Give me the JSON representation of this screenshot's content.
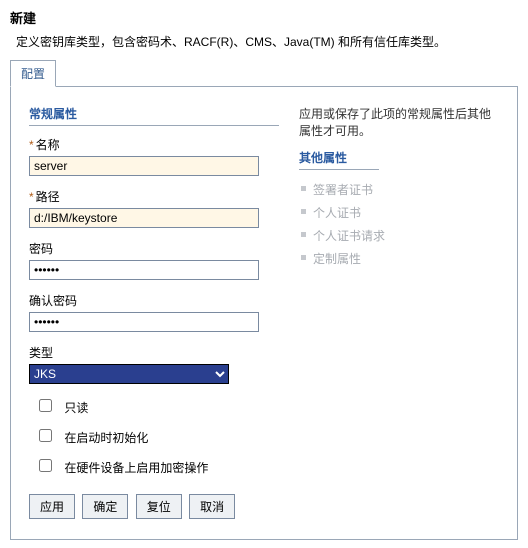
{
  "page": {
    "title": "新建",
    "description": "定义密钥库类型，包含密码术、RACF(R)、CMS、Java(TM) 和所有信任库类型。"
  },
  "tab": {
    "config": "配置"
  },
  "section": {
    "general": "常规属性"
  },
  "fields": {
    "name": {
      "label": "名称",
      "value": "server"
    },
    "path": {
      "label": "路径",
      "value": "d:/IBM/keystore"
    },
    "password": {
      "label": "密码",
      "value": "••••••"
    },
    "confirm": {
      "label": "确认密码",
      "value": "••••••"
    },
    "type": {
      "label": "类型",
      "selected": "JKS"
    },
    "readonly": {
      "label": "只读"
    },
    "init_on_start": {
      "label": "在启动时初始化"
    },
    "hw_crypto": {
      "label": "在硬件设备上启用加密操作"
    }
  },
  "buttons": {
    "apply": "应用",
    "ok": "确定",
    "reset": "复位",
    "cancel": "取消"
  },
  "side": {
    "note": "应用或保存了此项的常规属性后其他属性才可用。",
    "header": "其他属性",
    "items": [
      "签署者证书",
      "个人证书",
      "个人证书请求",
      "定制属性"
    ]
  }
}
